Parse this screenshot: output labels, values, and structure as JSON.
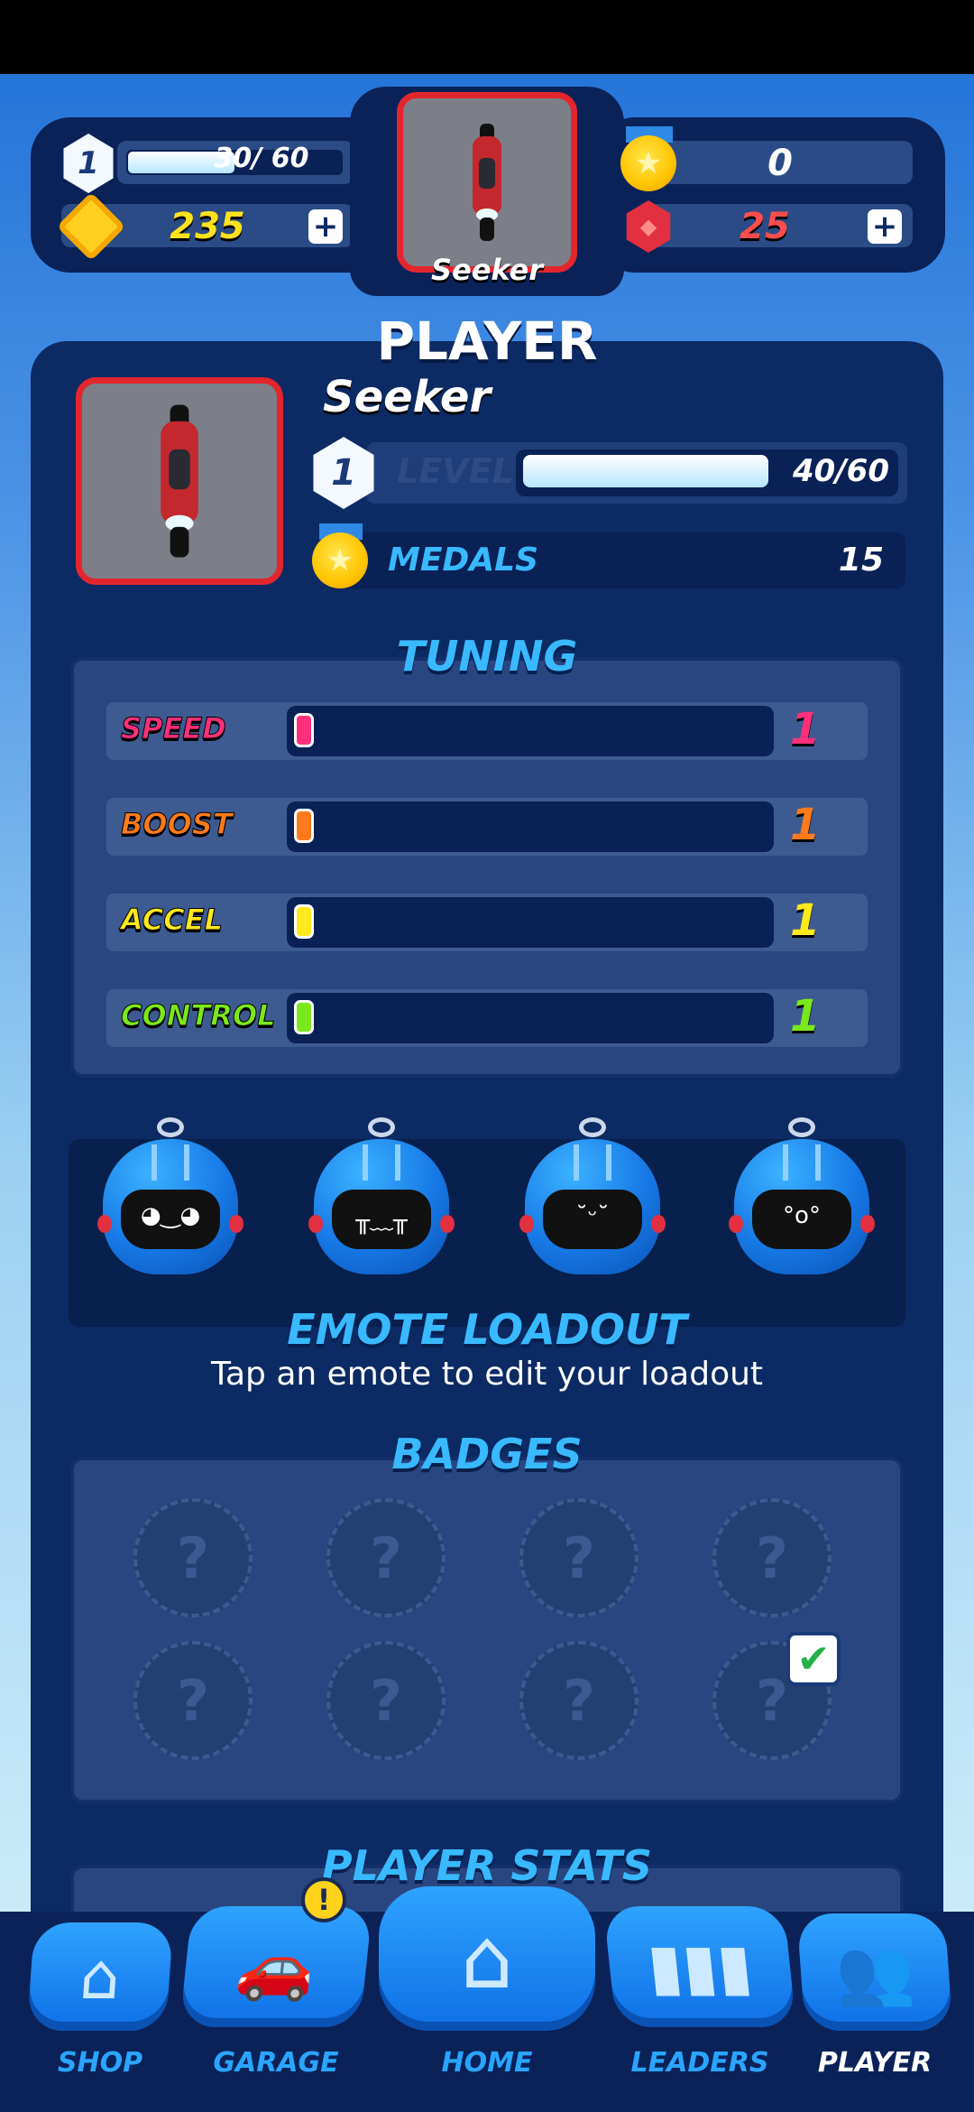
{
  "hud": {
    "level": "1",
    "xp_text": "30/ 60",
    "xp_fraction": 0.5,
    "coins": "235",
    "medals": "0",
    "rubies": "25",
    "player_name": "Seeker"
  },
  "player": {
    "title": "PLAYER",
    "name": "Seeker",
    "level": "1",
    "level_label": "LEVEL",
    "level_progress": "40/60",
    "level_fraction": 0.667,
    "medals_label": "MEDALS",
    "medals_value": "15"
  },
  "tuning": {
    "title": "TUNING",
    "stats": [
      {
        "label": "SPEED",
        "value": "1",
        "color": "#ff2f7a"
      },
      {
        "label": "BOOST",
        "value": "1",
        "color": "#ff7a1a"
      },
      {
        "label": "ACCEL",
        "value": "1",
        "color": "#ffe81c"
      },
      {
        "label": "CONTROL",
        "value": "1",
        "color": "#7be81c"
      }
    ]
  },
  "emotes": {
    "title": "EMOTE LOADOUT",
    "subtitle": "Tap an emote to edit your loadout",
    "faces": [
      "happy",
      "crying",
      "blushing",
      "surprised"
    ]
  },
  "badges": {
    "title": "BADGES",
    "slot_glyph": "?",
    "check_glyph": "✔"
  },
  "player_stats": {
    "title": "PLAYER STATS"
  },
  "nav": {
    "alert_glyph": "!",
    "items": [
      {
        "label": "SHOP",
        "icon": "shop-icon"
      },
      {
        "label": "GARAGE",
        "icon": "car-icon"
      },
      {
        "label": "HOME",
        "icon": "home-icon"
      },
      {
        "label": "LEADERS",
        "icon": "leaderboard-icon"
      },
      {
        "label": "PLAYER",
        "icon": "friends-icon"
      }
    ]
  },
  "icons": {
    "plus": "+",
    "medal": "★"
  }
}
